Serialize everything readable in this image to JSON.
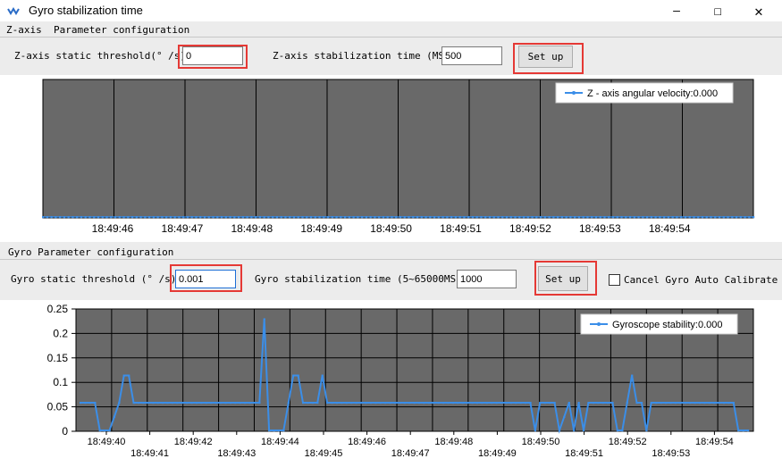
{
  "window": {
    "title": "Gyro stabilization time",
    "minimize_glyph": "—",
    "maximize_glyph": "☐",
    "close_glyph": "✕"
  },
  "z_axis": {
    "group_title": "Z-axis  Parameter configuration",
    "threshold_label": "Z-axis static threshold(° /s):",
    "threshold_value": "0",
    "time_label": "Z-axis stabilization time (MS):",
    "time_value": "500",
    "setup_label": "Set up"
  },
  "gyro": {
    "group_title": "Gyro Parameter configuration",
    "threshold_label": "Gyro static threshold (° /s):",
    "threshold_value": "0.001",
    "time_label": "Gyro stabilization time (5~65000MS):",
    "time_value": "1000",
    "setup_label": "Set up",
    "cancel_label": "Cancel Gyro Auto Calibrate"
  },
  "chart_data": [
    {
      "type": "line",
      "title": "",
      "legend": "Z - axis angular velocity:0.000",
      "legend_position": "top-right",
      "x_ticks": [
        "18:49:46",
        "18:49:47",
        "18:49:48",
        "18:49:49",
        "18:49:50",
        "18:49:51",
        "18:49:52",
        "18:49:53",
        "18:49:54"
      ],
      "y_ticks": [],
      "grid": true,
      "series": [
        {
          "name": "Z - axis angular velocity",
          "values": [
            0,
            0,
            0,
            0,
            0,
            0,
            0,
            0,
            0,
            0,
            0,
            0,
            0,
            0,
            0,
            0,
            0,
            0,
            0,
            0,
            0,
            0,
            0,
            0,
            0,
            0,
            0,
            0,
            0,
            0,
            0,
            0,
            0,
            0,
            0,
            0,
            0,
            0,
            0,
            0,
            0,
            0,
            0,
            0,
            0,
            0,
            0,
            0,
            0,
            0,
            0,
            0,
            0,
            0,
            0,
            0,
            0,
            0,
            0,
            0,
            0,
            0,
            0,
            0,
            0,
            0,
            0,
            0,
            0,
            0,
            0,
            0,
            0,
            0,
            0,
            0,
            0,
            0,
            0,
            0,
            0,
            0,
            0,
            0,
            0,
            0,
            0,
            0,
            0,
            0,
            0,
            0,
            0,
            0,
            0,
            0,
            0,
            0,
            0,
            0,
            0,
            0,
            0,
            0,
            0,
            0,
            0,
            0,
            0,
            0,
            0,
            0,
            0,
            0,
            0,
            0,
            0,
            0,
            0,
            0,
            0,
            0,
            0,
            0,
            0,
            0,
            0,
            0,
            0,
            0,
            0,
            0,
            0,
            0,
            0,
            0,
            0,
            0,
            0,
            0,
            0,
            0,
            0,
            0,
            0,
            0,
            0,
            0,
            0,
            0,
            0,
            0,
            0,
            0,
            0,
            0,
            0,
            0,
            0,
            0,
            0,
            0,
            0,
            0,
            0,
            0,
            0,
            0
          ]
        }
      ],
      "colors": {
        "plot_bg": "#696969",
        "line": "#3b8ee8",
        "grid": "#000000"
      }
    },
    {
      "type": "line",
      "title": "",
      "legend": "Gyroscope stability:0.000",
      "legend_position": "top-right",
      "ylim": [
        0,
        0.25
      ],
      "y_ticks": [
        "0.25",
        "0.2",
        "0.15",
        "0.1",
        "0.05",
        "0"
      ],
      "x_ticks_upper": [
        "18:49:40",
        "18:49:42",
        "18:49:44",
        "18:49:46",
        "18:49:48",
        "18:49:50",
        "18:49:52",
        "18:49:54"
      ],
      "x_ticks_lower": [
        "18:49:41",
        "18:49:43",
        "18:49:45",
        "18:49:47",
        "18:49:49",
        "18:49:51",
        "18:49:53"
      ],
      "grid": true,
      "series": [
        {
          "name": "Gyroscope stability",
          "values": [
            0.057,
            0.057,
            0.057,
            0.057,
            0,
            0,
            0,
            0.028,
            0.057,
            0.113,
            0.113,
            0.057,
            0.057,
            0.057,
            0.057,
            0.057,
            0.057,
            0.057,
            0.057,
            0.057,
            0.057,
            0.057,
            0.057,
            0.057,
            0.057,
            0.057,
            0.057,
            0.057,
            0.057,
            0.057,
            0.057,
            0.057,
            0.057,
            0.057,
            0.057,
            0.057,
            0.057,
            0.057,
            0.229,
            0,
            0,
            0,
            0,
            0.057,
            0.113,
            0.113,
            0.057,
            0.057,
            0.057,
            0.057,
            0.113,
            0.057,
            0.057,
            0.057,
            0.057,
            0.057,
            0.057,
            0.057,
            0.057,
            0.057,
            0.057,
            0.057,
            0.057,
            0.057,
            0.057,
            0.057,
            0.057,
            0.057,
            0.057,
            0.057,
            0.057,
            0.057,
            0.057,
            0.057,
            0.057,
            0.057,
            0.057,
            0.057,
            0.057,
            0.057,
            0.057,
            0.057,
            0.057,
            0.057,
            0.057,
            0.057,
            0.057,
            0.057,
            0.057,
            0.057,
            0.057,
            0.057,
            0.057,
            0.057,
            0,
            0.057,
            0.057,
            0.057,
            0.057,
            0,
            0.028,
            0.057,
            0,
            0.057,
            0,
            0.057,
            0.057,
            0.057,
            0.057,
            0.057,
            0.057,
            0,
            0,
            0.057,
            0.113,
            0.057,
            0.057,
            0,
            0.057,
            0.057,
            0.057,
            0.057,
            0.057,
            0.057,
            0.057,
            0.057,
            0.057,
            0.057,
            0.057,
            0.057,
            0.057,
            0.057,
            0.057,
            0.057,
            0.057,
            0.057,
            0,
            0,
            0
          ]
        }
      ],
      "colors": {
        "plot_bg": "#696969",
        "line": "#3b8ee8",
        "grid": "#000000"
      }
    }
  ]
}
